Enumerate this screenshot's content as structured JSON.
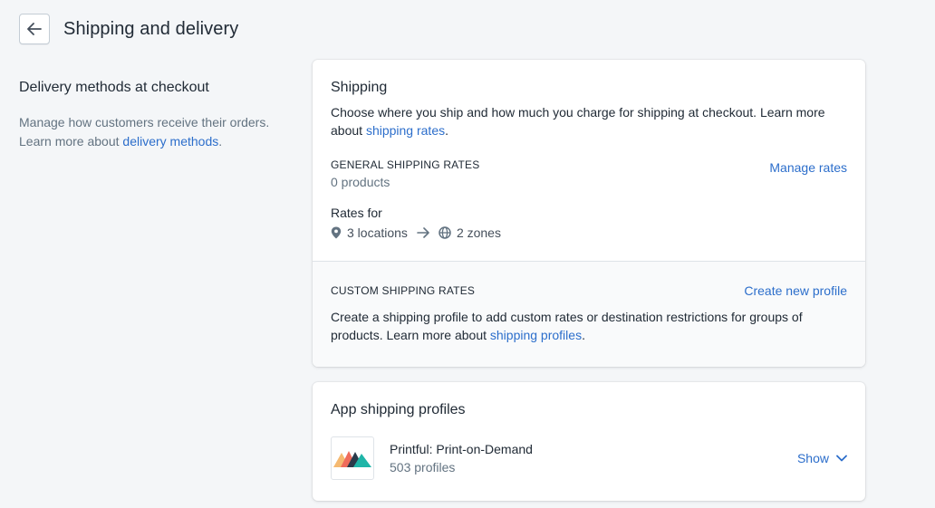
{
  "header": {
    "title": "Shipping and delivery",
    "back_icon": "arrow-left-icon"
  },
  "annotation": {
    "title": "Delivery methods at checkout",
    "desc_line1": "Manage how customers receive their orders.",
    "desc_prefix": "Learn more about ",
    "desc_link": "delivery methods",
    "desc_suffix": "."
  },
  "shipping": {
    "title": "Shipping",
    "desc_prefix": "Choose where you ship and how much you charge for shipping at checkout. Learn more about ",
    "desc_link": "shipping rates",
    "desc_suffix": ".",
    "general": {
      "heading": "GENERAL SHIPPING RATES",
      "products": "0 products",
      "manage_label": "Manage rates",
      "rates_for": "Rates for",
      "locations": "3 locations",
      "zones": "2 zones"
    },
    "custom": {
      "heading": "CUSTOM SHIPPING RATES",
      "create_label": "Create new profile",
      "desc_prefix": "Create a shipping profile to add custom rates or destination restrictions for groups of products. Learn more about ",
      "desc_link": "shipping profiles",
      "desc_suffix": "."
    }
  },
  "apps": {
    "title": "App shipping profiles",
    "items": [
      {
        "name": "Printful: Print-on-Demand",
        "count": "503 profiles",
        "action": "Show"
      }
    ]
  },
  "colors": {
    "link": "#2c6ecb",
    "text": "#212b36",
    "muted": "#637381",
    "bg": "#f4f6f8"
  }
}
